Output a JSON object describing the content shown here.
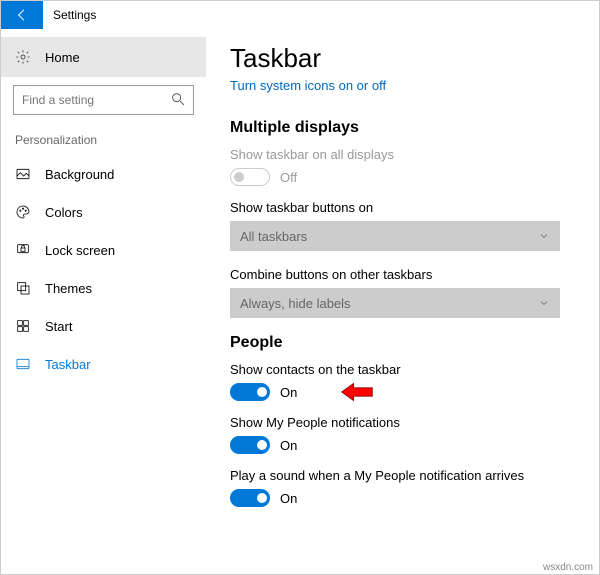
{
  "window": {
    "title": "Settings"
  },
  "sidebar": {
    "home": "Home",
    "search_placeholder": "Find a setting",
    "category": "Personalization",
    "items": [
      {
        "label": "Background"
      },
      {
        "label": "Colors"
      },
      {
        "label": "Lock screen"
      },
      {
        "label": "Themes"
      },
      {
        "label": "Start"
      },
      {
        "label": "Taskbar"
      }
    ]
  },
  "main": {
    "title": "Taskbar",
    "link": "Turn system icons on or off",
    "multi": {
      "heading": "Multiple displays",
      "show_all": "Show taskbar on all displays",
      "show_all_state": "Off",
      "buttons_on_label": "Show taskbar buttons on",
      "buttons_on_value": "All taskbars",
      "combine_label": "Combine buttons on other taskbars",
      "combine_value": "Always, hide labels"
    },
    "people": {
      "heading": "People",
      "contacts_label": "Show contacts on the taskbar",
      "contacts_state": "On",
      "notif_label": "Show My People notifications",
      "notif_state": "On",
      "sound_label": "Play a sound when a My People notification arrives",
      "sound_state": "On"
    }
  },
  "footer": "wsxdn.com"
}
